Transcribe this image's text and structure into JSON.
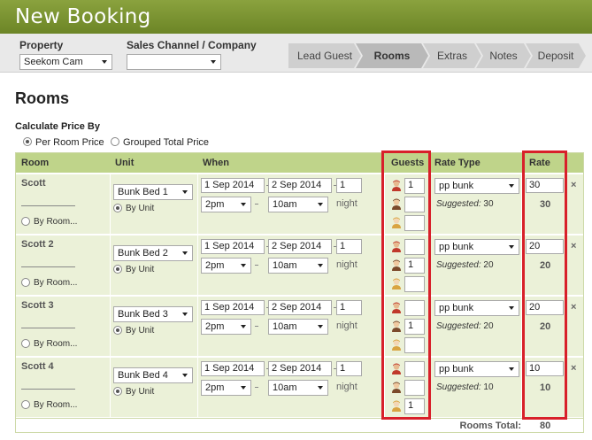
{
  "header": {
    "title": "New Booking"
  },
  "toolbar": {
    "property_label": "Property",
    "property_value": "Seekom Cam",
    "channel_label": "Sales Channel / Company",
    "channel_value": ""
  },
  "steps": [
    "Lead Guest",
    "Rooms",
    "Extras",
    "Notes",
    "Deposit"
  ],
  "active_step": "Rooms",
  "section_title": "Rooms",
  "calc": {
    "label": "Calculate Price By",
    "per_room": "Per Room Price",
    "grouped": "Grouped Total Price",
    "selected": "per_room"
  },
  "columns": {
    "room": "Room",
    "unit": "Unit",
    "when": "When",
    "guests": "Guests",
    "rate_type": "Rate Type",
    "rate": "Rate"
  },
  "rows": [
    {
      "room": "Scott",
      "unit": "Bunk Bed 1",
      "by_unit": "By Unit",
      "by_room": "By Room...",
      "from": "1 Sep 2014",
      "to": "2 Sep 2014",
      "nights": "1",
      "time_in": "2pm",
      "time_out": "10am",
      "night_label": "night",
      "guests": [
        "1",
        "",
        ""
      ],
      "rate_type": "pp bunk",
      "suggested_label": "Suggested:",
      "suggested": "30",
      "rate": "30",
      "rate_total": "30",
      "remove": "×"
    },
    {
      "room": "Scott 2",
      "unit": "Bunk Bed 2",
      "by_unit": "By Unit",
      "by_room": "By Room...",
      "from": "1 Sep 2014",
      "to": "2 Sep 2014",
      "nights": "1",
      "time_in": "2pm",
      "time_out": "10am",
      "night_label": "night",
      "guests": [
        "",
        "1",
        ""
      ],
      "rate_type": "pp bunk",
      "suggested_label": "Suggested:",
      "suggested": "20",
      "rate": "20",
      "rate_total": "20",
      "remove": "×"
    },
    {
      "room": "Scott 3",
      "unit": "Bunk Bed 3",
      "by_unit": "By Unit",
      "by_room": "By Room...",
      "from": "1 Sep 2014",
      "to": "2 Sep 2014",
      "nights": "1",
      "time_in": "2pm",
      "time_out": "10am",
      "night_label": "night",
      "guests": [
        "",
        "1",
        ""
      ],
      "rate_type": "pp bunk",
      "suggested_label": "Suggested:",
      "suggested": "20",
      "rate": "20",
      "rate_total": "20",
      "remove": "×"
    },
    {
      "room": "Scott 4",
      "unit": "Bunk Bed 4",
      "by_unit": "By Unit",
      "by_room": "By Room...",
      "from": "1 Sep 2014",
      "to": "2 Sep 2014",
      "nights": "1",
      "time_in": "2pm",
      "time_out": "10am",
      "night_label": "night",
      "guests": [
        "",
        "",
        "1"
      ],
      "rate_type": "pp bunk",
      "suggested_label": "Suggested:",
      "suggested": "10",
      "rate": "10",
      "rate_total": "10",
      "remove": "×"
    }
  ],
  "totals": {
    "label": "Rooms Total:",
    "value": "80"
  },
  "colors": {
    "header": "#7a9330",
    "row_bg": "#ebf1d8",
    "head_bg": "#bfd48a",
    "highlight": "#d8202a"
  },
  "icons": [
    "adult-guest-icon",
    "child-guest-icon",
    "infant-guest-icon",
    "remove-icon",
    "chevron-down-icon"
  ]
}
